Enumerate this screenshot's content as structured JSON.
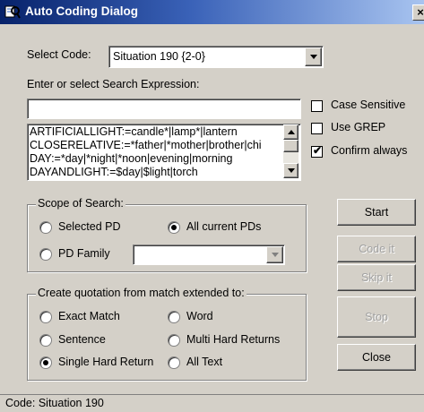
{
  "window": {
    "title": "Auto Coding Dialog",
    "close_glyph": "×"
  },
  "select_code": {
    "label": "Select Code:",
    "value": "Situation 190 {2-0}"
  },
  "search": {
    "label": "Enter or select Search Expression:",
    "value": "",
    "list": [
      "ARTIFICIALLIGHT:=candle*|lamp*|lantern",
      "CLOSERELATIVE:=*father|*mother|brother|chi",
      "DAY:=*day|*night|*noon|evening|morning",
      "DAYANDLIGHT:=$day|$light|torch"
    ]
  },
  "options": {
    "case_sensitive": {
      "label": "Case Sensitive",
      "checked": false
    },
    "use_grep": {
      "label": "Use GREP",
      "checked": false
    },
    "confirm_always": {
      "label": "Confirm always",
      "checked": true
    }
  },
  "scope": {
    "title": "Scope of Search:",
    "selected_pd": "Selected PD",
    "all_current_pds": "All current PDs",
    "pd_family": "PD Family",
    "pd_family_value": "",
    "selected": "all_current_pds"
  },
  "quotation": {
    "title": "Create quotation from match extended to:",
    "exact_match": "Exact Match",
    "word": "Word",
    "sentence": "Sentence",
    "multi_hard_returns": "Multi Hard Returns",
    "single_hard_return": "Single Hard Return",
    "all_text": "All Text",
    "selected": "single_hard_return"
  },
  "buttons": {
    "start": "Start",
    "code_it": "Code it",
    "skip_it": "Skip it",
    "stop": "Stop",
    "close": "Close"
  },
  "status": {
    "text": "Code: Situation 190"
  },
  "colors": {
    "face": "#d4d0c8",
    "title_start": "#07226a",
    "title_end": "#a8c4f0"
  }
}
